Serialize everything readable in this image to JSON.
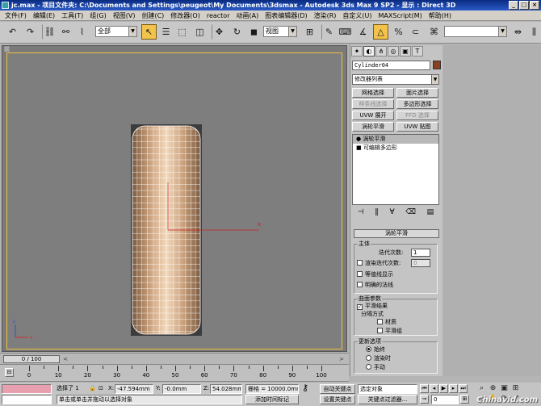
{
  "window": {
    "title": "jc.max - 项目文件夹: C:\\Documents and Settings\\peugeot\\My Documents\\3dsmax - Autodesk 3ds Max 9 SP2 - 显示 : Direct 3D",
    "min": "_",
    "max": "□",
    "close": "×"
  },
  "menu": [
    "文件(F)",
    "编辑(E)",
    "工具(T)",
    "组(G)",
    "视图(V)",
    "创建(C)",
    "修改器(O)",
    "reactor",
    "动画(A)",
    "图表编辑器(D)",
    "渲染(R)",
    "自定义(U)",
    "MAXScript(M)",
    "帮助(H)"
  ],
  "toolbar": {
    "filter": "全部",
    "refcoord": "视图"
  },
  "viewport": {
    "label": "前",
    "object_color": "#caa688",
    "selection_color": "#cc2222"
  },
  "panel": {
    "object_name": "Cylinder04",
    "object_color": "#8a4020",
    "modifier_list": "修改器列表",
    "buttons": [
      {
        "label": "网格选择",
        "enabled": true
      },
      {
        "label": "面片选择",
        "enabled": true
      },
      {
        "label": "样条线选择",
        "enabled": false
      },
      {
        "label": "多边形选择",
        "enabled": true
      },
      {
        "label": "UVW 展开",
        "enabled": true
      },
      {
        "label": "FFD 选择",
        "enabled": false
      },
      {
        "label": "涡轮平滑",
        "enabled": true
      },
      {
        "label": "UVW 贴图",
        "enabled": true
      }
    ],
    "stack": [
      {
        "label": "涡轮平滑",
        "bullet": "●"
      },
      {
        "label": "可编辑多边形",
        "bullet": "■"
      }
    ],
    "rollout_title": "涡轮平滑",
    "main_group": "主体",
    "iterations_label": "迭代次数:",
    "iterations_value": "1",
    "render_iters_label": "渲染迭代次数:",
    "render_iters_value": "0",
    "isoline": "等值线显示",
    "explicit_normals": "明确的法线",
    "surface_group": "曲面参数",
    "smooth_result": "平滑结果",
    "separate_by": "分隔方式",
    "materials": "材质",
    "smoothing_groups": "平滑组",
    "update_group": "更新选项",
    "always": "始终",
    "when_rendering": "渲染时",
    "manually": "手动"
  },
  "timeline": {
    "range": "0 / 100",
    "prev": "<",
    "next": ">"
  },
  "ruler": {
    "labels": [
      "0",
      "10",
      "20",
      "30",
      "40",
      "50",
      "60",
      "70",
      "80",
      "90",
      "100"
    ]
  },
  "status": {
    "selected": "选择了 1",
    "x_label": "X:",
    "x_value": "-47.594mm",
    "y_label": "Y:",
    "y_value": "-0.0mm",
    "z_label": "Z:",
    "z_value": "54.028mm",
    "grid": "栅格 = 10000.0mm",
    "autokey": "自动关键点",
    "setkey": "设置关键点",
    "selection_set": "选定对象",
    "key_filters": "关键点过滤器...",
    "frame": "0",
    "prompt": "单击或单击并拖动以选择对象",
    "add_time_tag": "添加时间标记"
  },
  "watermark": "Chinavid.com"
}
